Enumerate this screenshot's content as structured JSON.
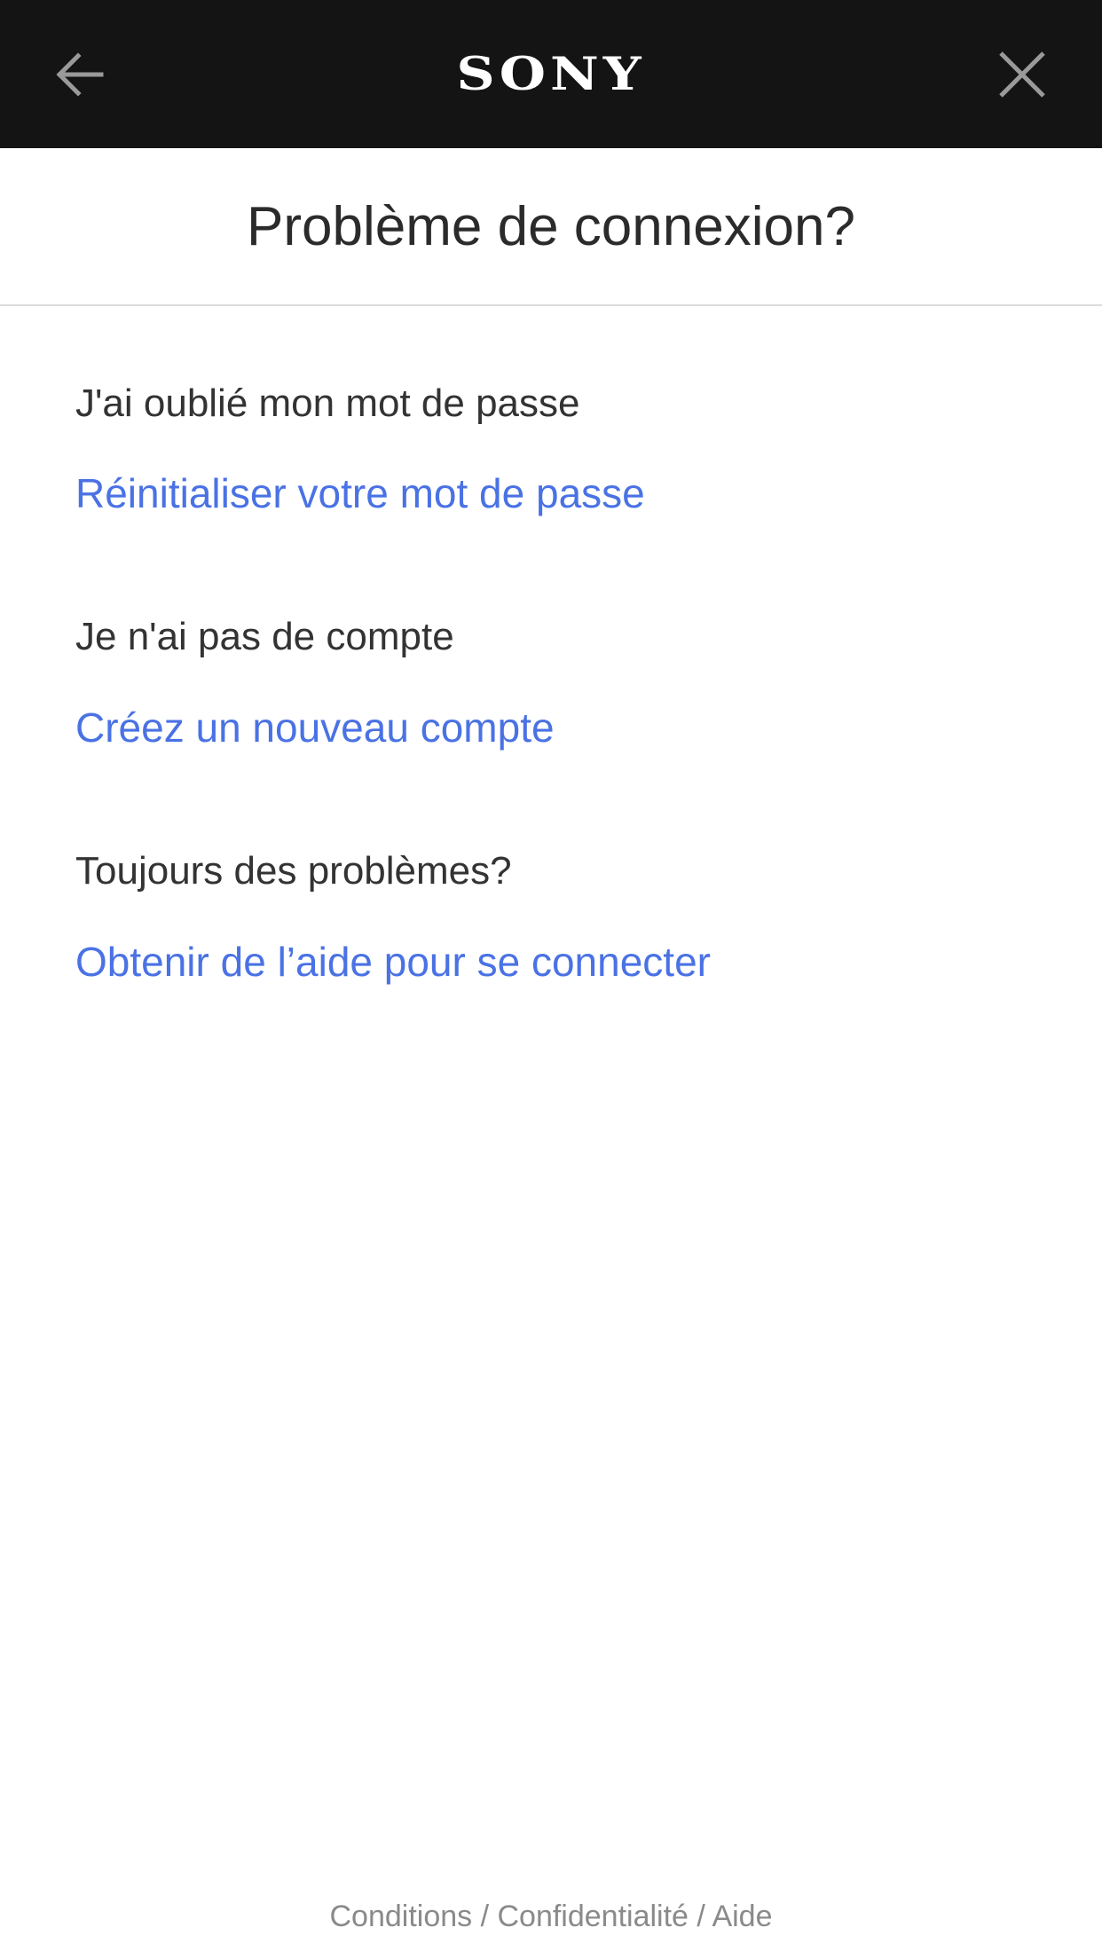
{
  "header": {
    "logo_text": "SONY",
    "back_icon": "arrow-left-icon",
    "close_icon": "close-icon",
    "background_color": "#141414"
  },
  "page": {
    "title": "Problème de connexion?"
  },
  "sections": [
    {
      "label": "J'ai oublié mon mot de passe",
      "link": "Réinitialiser votre mot de passe"
    },
    {
      "label": "Je n'ai pas de compte",
      "link": "Créez un nouveau compte"
    },
    {
      "label": "Toujours des problèmes?",
      "link": "Obtenir de l’aide pour se connecter"
    }
  ],
  "footer": {
    "terms": "Conditions",
    "privacy": "Confidentialité",
    "help": "Aide",
    "separator": " / "
  },
  "colors": {
    "link": "#4a72e4",
    "text": "#333333",
    "footer_text": "#8a8a8a"
  }
}
